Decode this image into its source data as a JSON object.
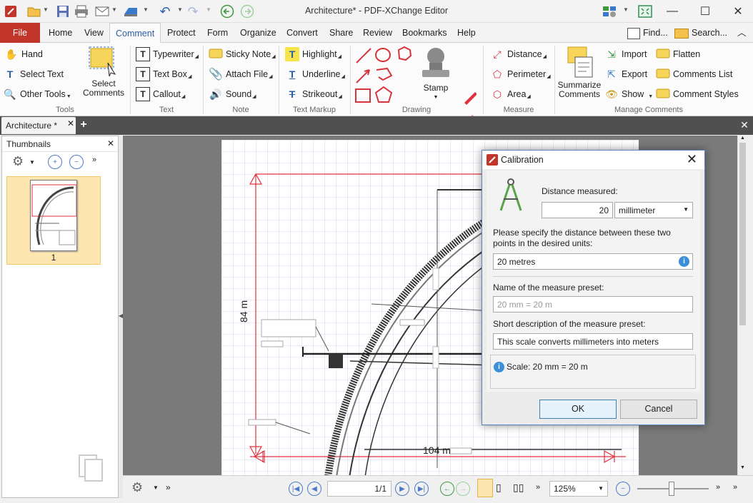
{
  "window": {
    "title": "Architecture* - PDF-XChange Editor",
    "controls": [
      "minimize-icon",
      "maximize-icon",
      "close-icon"
    ]
  },
  "menu": {
    "items": [
      "File",
      "Home",
      "View",
      "Comment",
      "Protect",
      "Form",
      "Organize",
      "Convert",
      "Share",
      "Review",
      "Bookmarks",
      "Help"
    ],
    "active": "Comment",
    "find": "Find...",
    "search": "Search..."
  },
  "ribbon": {
    "tools": {
      "hand": "Hand",
      "select_text": "Select Text",
      "other_tools": "Other Tools",
      "select_comments": "Select Comments",
      "label": "Tools"
    },
    "text": {
      "typewriter": "Typewriter",
      "text_box": "Text Box",
      "callout": "Callout",
      "label": "Text"
    },
    "note": {
      "sticky_note": "Sticky Note",
      "attach_file": "Attach File",
      "sound": "Sound",
      "label": "Note"
    },
    "markup": {
      "highlight": "Highlight",
      "underline": "Underline",
      "strikeout": "Strikeout",
      "label": "Text Markup"
    },
    "drawing": {
      "stamp": "Stamp",
      "label": "Drawing"
    },
    "measure": {
      "distance": "Distance",
      "perimeter": "Perimeter",
      "area": "Area",
      "label": "Measure"
    },
    "manage": {
      "summarize": "Summarize Comments",
      "import": "Import",
      "export": "Export",
      "show": "Show",
      "flatten": "Flatten",
      "comments_list": "Comments List",
      "comment_styles": "Comment Styles",
      "label": "Manage Comments"
    }
  },
  "doc_tab": {
    "label": "Architecture *"
  },
  "thumbnails": {
    "title": "Thumbnails",
    "page_number": "1"
  },
  "page": {
    "dimension_vertical": "84 m",
    "dimension_horizontal": "104 m"
  },
  "statusbar": {
    "page": "1/1",
    "zoom": "125%"
  },
  "dialog": {
    "title": "Calibration",
    "distance_label": "Distance measured:",
    "distance_value": "20",
    "unit": "millimeter",
    "specify_label": "Please specify the distance between these two points in the desired units:",
    "specify_value": "20 metres",
    "preset_name_label": "Name of the measure preset:",
    "preset_name_placeholder": "20 mm = 20 m",
    "description_label": "Short description of the measure preset:",
    "description_value": "This scale converts millimeters into meters",
    "scale_info": "Scale: 20 mm = 20 m",
    "ok": "OK",
    "cancel": "Cancel"
  },
  "colors": {
    "file_tab": "#c1352b",
    "accent": "#2a5ea8",
    "measure_red": "#e0323c",
    "selection": "#fde6b0"
  }
}
